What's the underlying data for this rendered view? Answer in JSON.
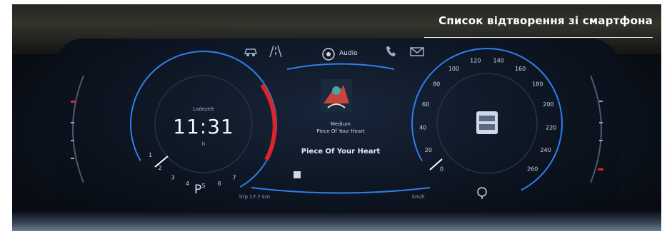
{
  "caption": "Список відтворення зі смартфона",
  "top_bar": {
    "audio_label": "Audio",
    "icons": [
      "car-icon",
      "road-icon",
      "audio-icon",
      "phone-icon",
      "message-icon"
    ]
  },
  "left_gauge": {
    "type": "rpm",
    "ticks": [
      "1",
      "2",
      "3",
      "4",
      "5",
      "6",
      "7"
    ],
    "clock_label": "Ladezeit",
    "clock_time": "11:31",
    "clock_unit": "h",
    "gear": "P",
    "red_zone_color": "#d9262b",
    "accent_color": "#2f7ff0"
  },
  "center_media": {
    "source_label": "Medium",
    "track_small": "Piece Of Your Heart",
    "track_main": "Piece Of Your Heart",
    "trip_left": "trip 17.7 km",
    "trip_right": "km/h"
  },
  "right_gauge": {
    "type": "speed",
    "ticks": [
      "0",
      "20",
      "40",
      "60",
      "80",
      "100",
      "120",
      "140",
      "160",
      "180",
      "200",
      "220",
      "240",
      "260"
    ],
    "accent_color": "#2f7ff0"
  },
  "colors": {
    "background": "#0b111b",
    "gauge_blue": "#2f7ff0",
    "needle": "#ffffff",
    "red_zone": "#d9262b"
  }
}
